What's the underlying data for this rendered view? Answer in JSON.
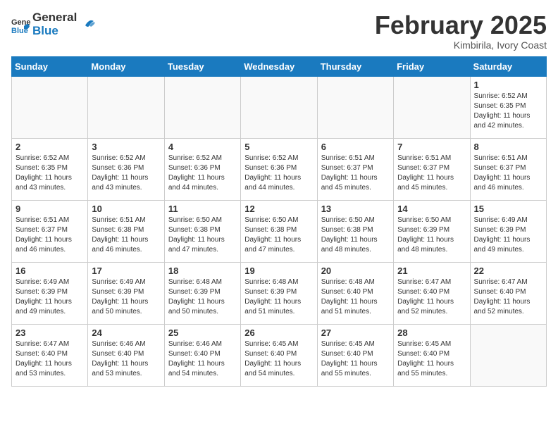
{
  "header": {
    "logo_general": "General",
    "logo_blue": "Blue",
    "month_title": "February 2025",
    "location": "Kimbirila, Ivory Coast"
  },
  "weekdays": [
    "Sunday",
    "Monday",
    "Tuesday",
    "Wednesday",
    "Thursday",
    "Friday",
    "Saturday"
  ],
  "weeks": [
    [
      {
        "day": "",
        "info": ""
      },
      {
        "day": "",
        "info": ""
      },
      {
        "day": "",
        "info": ""
      },
      {
        "day": "",
        "info": ""
      },
      {
        "day": "",
        "info": ""
      },
      {
        "day": "",
        "info": ""
      },
      {
        "day": "1",
        "info": "Sunrise: 6:52 AM\nSunset: 6:35 PM\nDaylight: 11 hours and 42 minutes."
      }
    ],
    [
      {
        "day": "2",
        "info": "Sunrise: 6:52 AM\nSunset: 6:35 PM\nDaylight: 11 hours and 43 minutes."
      },
      {
        "day": "3",
        "info": "Sunrise: 6:52 AM\nSunset: 6:36 PM\nDaylight: 11 hours and 43 minutes."
      },
      {
        "day": "4",
        "info": "Sunrise: 6:52 AM\nSunset: 6:36 PM\nDaylight: 11 hours and 44 minutes."
      },
      {
        "day": "5",
        "info": "Sunrise: 6:52 AM\nSunset: 6:36 PM\nDaylight: 11 hours and 44 minutes."
      },
      {
        "day": "6",
        "info": "Sunrise: 6:51 AM\nSunset: 6:37 PM\nDaylight: 11 hours and 45 minutes."
      },
      {
        "day": "7",
        "info": "Sunrise: 6:51 AM\nSunset: 6:37 PM\nDaylight: 11 hours and 45 minutes."
      },
      {
        "day": "8",
        "info": "Sunrise: 6:51 AM\nSunset: 6:37 PM\nDaylight: 11 hours and 46 minutes."
      }
    ],
    [
      {
        "day": "9",
        "info": "Sunrise: 6:51 AM\nSunset: 6:37 PM\nDaylight: 11 hours and 46 minutes."
      },
      {
        "day": "10",
        "info": "Sunrise: 6:51 AM\nSunset: 6:38 PM\nDaylight: 11 hours and 46 minutes."
      },
      {
        "day": "11",
        "info": "Sunrise: 6:50 AM\nSunset: 6:38 PM\nDaylight: 11 hours and 47 minutes."
      },
      {
        "day": "12",
        "info": "Sunrise: 6:50 AM\nSunset: 6:38 PM\nDaylight: 11 hours and 47 minutes."
      },
      {
        "day": "13",
        "info": "Sunrise: 6:50 AM\nSunset: 6:38 PM\nDaylight: 11 hours and 48 minutes."
      },
      {
        "day": "14",
        "info": "Sunrise: 6:50 AM\nSunset: 6:39 PM\nDaylight: 11 hours and 48 minutes."
      },
      {
        "day": "15",
        "info": "Sunrise: 6:49 AM\nSunset: 6:39 PM\nDaylight: 11 hours and 49 minutes."
      }
    ],
    [
      {
        "day": "16",
        "info": "Sunrise: 6:49 AM\nSunset: 6:39 PM\nDaylight: 11 hours and 49 minutes."
      },
      {
        "day": "17",
        "info": "Sunrise: 6:49 AM\nSunset: 6:39 PM\nDaylight: 11 hours and 50 minutes."
      },
      {
        "day": "18",
        "info": "Sunrise: 6:48 AM\nSunset: 6:39 PM\nDaylight: 11 hours and 50 minutes."
      },
      {
        "day": "19",
        "info": "Sunrise: 6:48 AM\nSunset: 6:39 PM\nDaylight: 11 hours and 51 minutes."
      },
      {
        "day": "20",
        "info": "Sunrise: 6:48 AM\nSunset: 6:40 PM\nDaylight: 11 hours and 51 minutes."
      },
      {
        "day": "21",
        "info": "Sunrise: 6:47 AM\nSunset: 6:40 PM\nDaylight: 11 hours and 52 minutes."
      },
      {
        "day": "22",
        "info": "Sunrise: 6:47 AM\nSunset: 6:40 PM\nDaylight: 11 hours and 52 minutes."
      }
    ],
    [
      {
        "day": "23",
        "info": "Sunrise: 6:47 AM\nSunset: 6:40 PM\nDaylight: 11 hours and 53 minutes."
      },
      {
        "day": "24",
        "info": "Sunrise: 6:46 AM\nSunset: 6:40 PM\nDaylight: 11 hours and 53 minutes."
      },
      {
        "day": "25",
        "info": "Sunrise: 6:46 AM\nSunset: 6:40 PM\nDaylight: 11 hours and 54 minutes."
      },
      {
        "day": "26",
        "info": "Sunrise: 6:45 AM\nSunset: 6:40 PM\nDaylight: 11 hours and 54 minutes."
      },
      {
        "day": "27",
        "info": "Sunrise: 6:45 AM\nSunset: 6:40 PM\nDaylight: 11 hours and 55 minutes."
      },
      {
        "day": "28",
        "info": "Sunrise: 6:45 AM\nSunset: 6:40 PM\nDaylight: 11 hours and 55 minutes."
      },
      {
        "day": "",
        "info": ""
      }
    ]
  ]
}
